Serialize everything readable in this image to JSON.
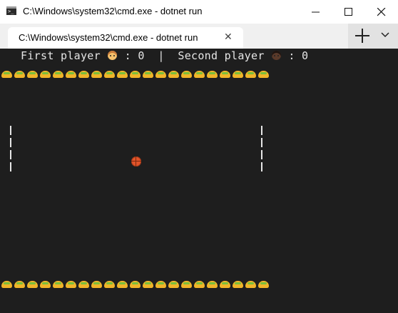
{
  "window": {
    "title": "C:\\Windows\\system32\\cmd.exe - dotnet  run"
  },
  "tab": {
    "title": "C:\\Windows\\system32\\cmd.exe - dotnet  run",
    "close_glyph": "✕"
  },
  "score": {
    "first_label": "First player",
    "first_value": "0",
    "separator": "|",
    "second_label": "Second player",
    "second_value": "0"
  },
  "icons": {
    "app": "cmd-icon",
    "minimize": "minimize-icon",
    "maximize": "maximize-icon",
    "close": "close-icon",
    "new_tab": "plus-icon",
    "dropdown": "chevron-down-icon",
    "player1": "face-emoji-icon",
    "player2": "face-emoji-dark-icon",
    "wall": "taco-emoji-icon",
    "ball": "basketball-emoji-icon"
  },
  "colors": {
    "console_bg": "#1e1e1e",
    "console_text": "#e6e6e6",
    "titlebar_bg": "#ffffff",
    "tabstrip_bg": "#f0f0f0",
    "taco": "#f0b429",
    "ball": "#e1542a"
  },
  "game": {
    "top_wall_count": 21,
    "bottom_wall_count": 21,
    "paddle_segments": 4
  }
}
